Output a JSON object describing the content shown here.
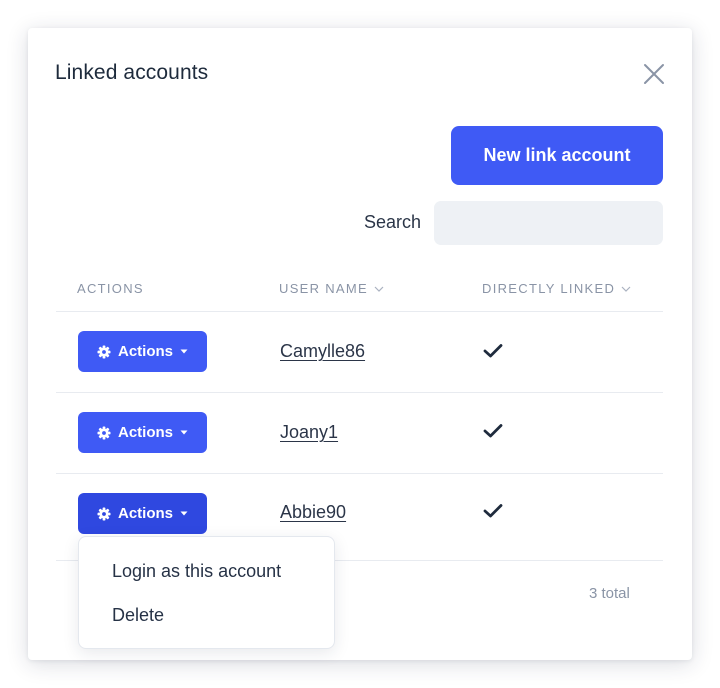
{
  "modal": {
    "title": "Linked accounts",
    "close_icon": "close-icon"
  },
  "toolbar": {
    "new_link_label": "New link account",
    "search_label": "Search",
    "search_value": "",
    "search_placeholder": ""
  },
  "table": {
    "columns": [
      {
        "label": "ACTIONS",
        "sortable": false
      },
      {
        "label": "USER NAME",
        "sortable": true,
        "sort_icon": "chevron-down-icon"
      },
      {
        "label": "DIRECTLY LINKED",
        "sortable": true,
        "sort_icon": "chevron-down-icon"
      }
    ],
    "rows": [
      {
        "actions_label": "Actions",
        "user_name": "Camylle86",
        "directly_linked": true
      },
      {
        "actions_label": "Actions",
        "user_name": "Joany1",
        "directly_linked": true
      },
      {
        "actions_label": "Actions",
        "user_name": "Abbie90",
        "directly_linked": true
      }
    ],
    "total": "3 total"
  },
  "actions_menu": {
    "open_for_row": 2,
    "items": [
      "Login as this account",
      "Delete"
    ]
  },
  "colors": {
    "accent": "#3f5af5",
    "accent_pressed": "#2f48e0",
    "text": "#1f2d3d",
    "muted": "#8a94a6",
    "input_bg": "#eef1f5",
    "divider": "#e8ebf0"
  },
  "icons": {
    "actions_button": [
      "gear-icon",
      "caret-down-icon"
    ],
    "linked_status": "check-icon"
  }
}
